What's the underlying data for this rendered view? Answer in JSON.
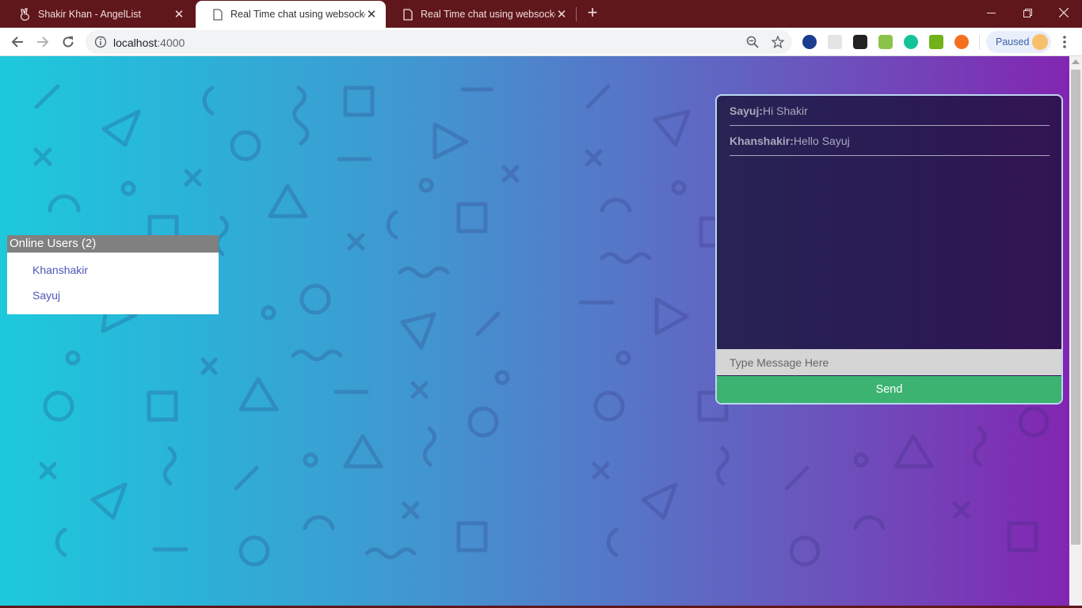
{
  "browser": {
    "tabs": [
      {
        "title": "Shakir Khan - AngelList",
        "active": false
      },
      {
        "title": "Real Time chat using websockets",
        "active": true
      },
      {
        "title": "Real Time chat using websockets",
        "active": false
      }
    ],
    "url_host": "localhost",
    "url_port": ":4000",
    "profile_label": "Paused",
    "accent": "#5f171c"
  },
  "users_panel": {
    "title": "Online Users (2)",
    "users": [
      "Khanshakir",
      "Sayuj"
    ]
  },
  "chat": {
    "messages": [
      {
        "user": "Sayuj:",
        "text": "Hi Shakir"
      },
      {
        "user": "Khanshakir:",
        "text": "Hello Sayuj"
      }
    ],
    "input_placeholder": "Type Message Here",
    "send_label": "Send",
    "send_color": "#3cb371"
  }
}
